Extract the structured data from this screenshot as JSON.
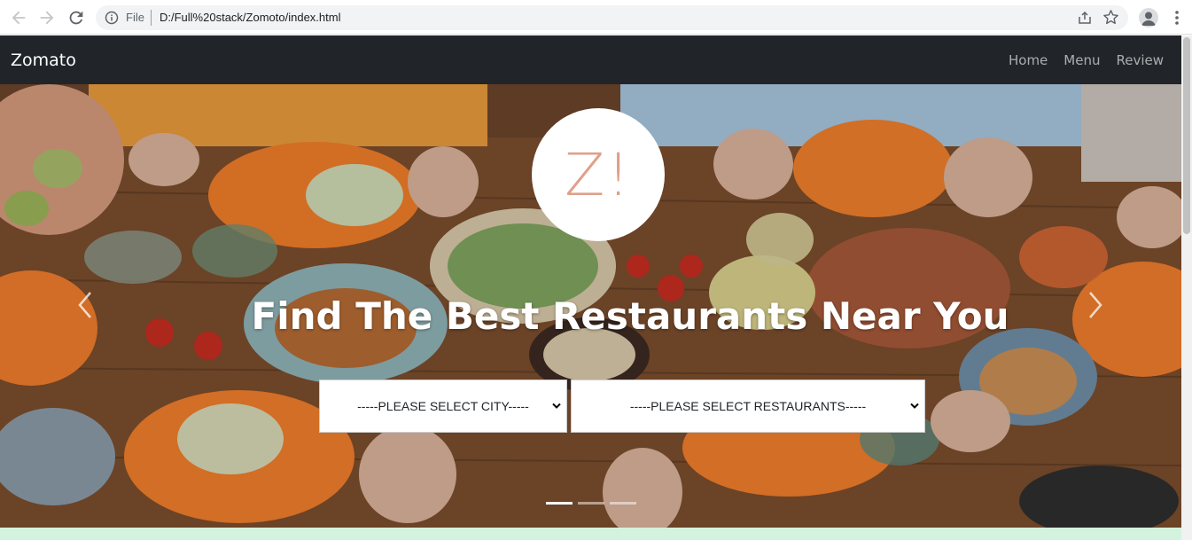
{
  "browser": {
    "scheme_label": "File",
    "url": "D:/Full%20stack/Zomoto/index.html"
  },
  "navbar": {
    "brand": "Zomato",
    "links": [
      "Home",
      "Menu",
      "Review"
    ]
  },
  "hero": {
    "logo_text": "Z!",
    "title": "Find The Best Restaurants Near You",
    "city_select": "-----PLEASE SELECT CITY-----",
    "restaurant_select": "-----PLEASE SELECT RESTAURANTS-----",
    "slide_count": 3,
    "active_slide": 1
  },
  "colors": {
    "navbar_bg": "#212529",
    "logo_text": "#e0a08a",
    "bottom_strip": "#d4f3df"
  }
}
